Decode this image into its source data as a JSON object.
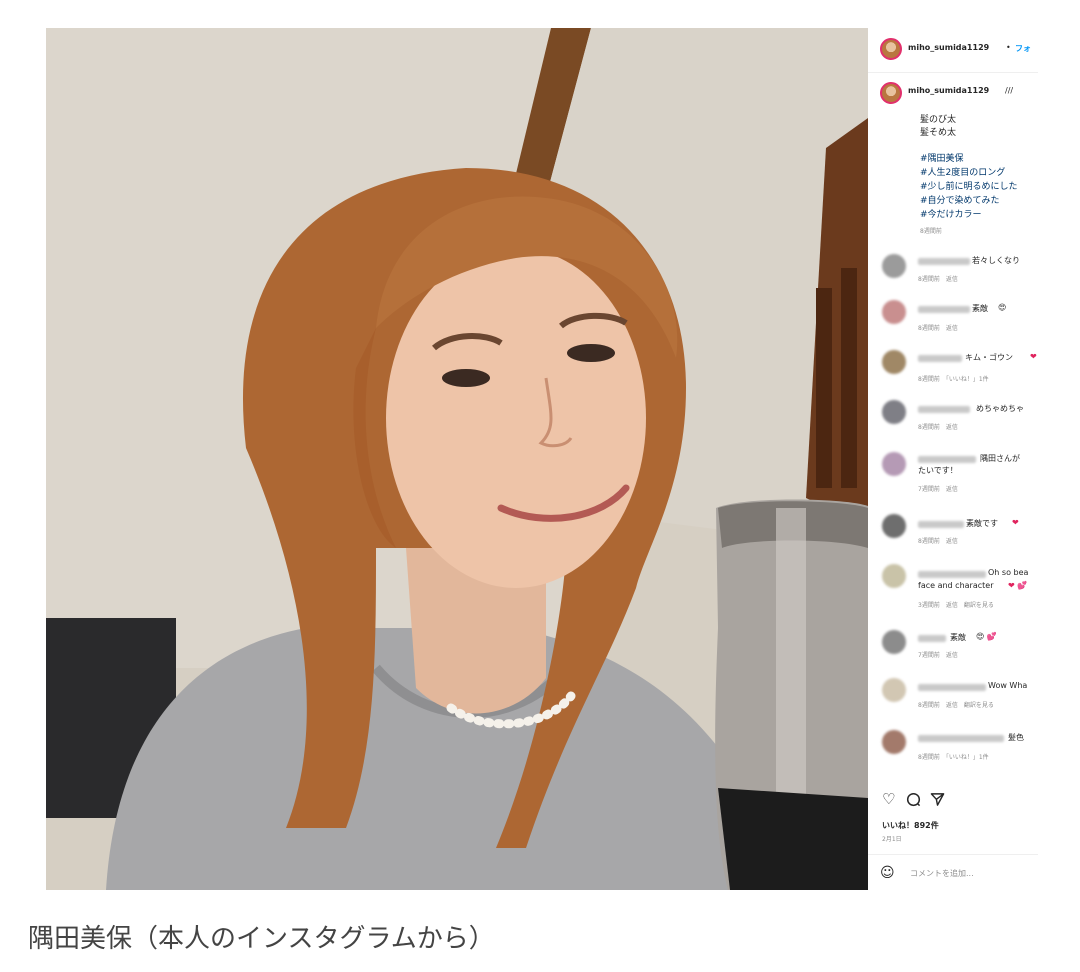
{
  "post": {
    "username": "miho_sumida1129",
    "follow_sep": "•",
    "follow_label": "フォ",
    "caption_user": "miho_sumida1129",
    "caption_suffix": "///",
    "caption_lines": [
      "髪のび太",
      "髪そめ太"
    ],
    "hashtags": [
      "#隅田美保",
      "#人生2度目のロング",
      "#少し前に明るめにした",
      "#自分で染めてみた",
      "#今だけカラー"
    ],
    "caption_time": "8週間前"
  },
  "comments": [
    {
      "text": "若々しくなり",
      "line2": "",
      "meta": "8週間前　返信",
      "avatar_color": "#9b9b9b"
    },
    {
      "text": "素敵",
      "emoji": "😍",
      "line2": "",
      "meta": "8週間前　返信",
      "avatar_color": "#c98f8f"
    },
    {
      "text": "キム・ゴウン",
      "emoji": "❤",
      "line2": "",
      "meta": "8週間前　「いいね！」1件",
      "avatar_color": "#a08866"
    },
    {
      "text": "めちゃめちゃ",
      "line2": "",
      "meta": "8週間前　返信",
      "avatar_color": "#7f7f86"
    },
    {
      "text": "隅田さんが",
      "line2": "たいです！",
      "meta": "7週間前　返信",
      "avatar_color": "#b59ab5"
    },
    {
      "text": "素敵です",
      "emoji": "❤",
      "line2": "",
      "meta": "8週間前　返信",
      "avatar_color": "#6e6e6e"
    },
    {
      "text": "Oh so bea",
      "line2": "face and character",
      "emoji": "❤ 💕",
      "meta": "3週間前　返信　翻訳を見る",
      "avatar_color": "#c9c3a8"
    },
    {
      "text": "素敵",
      "emoji": "😍 💕",
      "line2": "",
      "meta": "7週間前　返信",
      "avatar_color": "#8c8c8c"
    },
    {
      "text": "Wow Wha",
      "line2": "",
      "meta": "8週間前　返信　翻訳を見る",
      "avatar_color": "#d2c7b3"
    },
    {
      "text": "髪色",
      "line2": "",
      "meta": "8週間前　「いいね！」1件",
      "avatar_color": "#a37a6b"
    }
  ],
  "actions": {
    "like_icon": "heart-icon",
    "comment_icon": "comment-icon",
    "share_icon": "share-icon"
  },
  "likes_label": "いいね！892件",
  "post_date": "2月1日",
  "comment_input": {
    "placeholder": "コメントを追加...",
    "emoji_icon": "smiley-icon"
  },
  "photo_caption": "隅田美保（本人のインスタグラムから）",
  "colors": {
    "link": "#00376b",
    "follow": "#0095f6",
    "meta": "#8e8e8e",
    "wall": "#d7d0c4",
    "hair": "#b06a35",
    "sweater": "#a7a7a7"
  }
}
